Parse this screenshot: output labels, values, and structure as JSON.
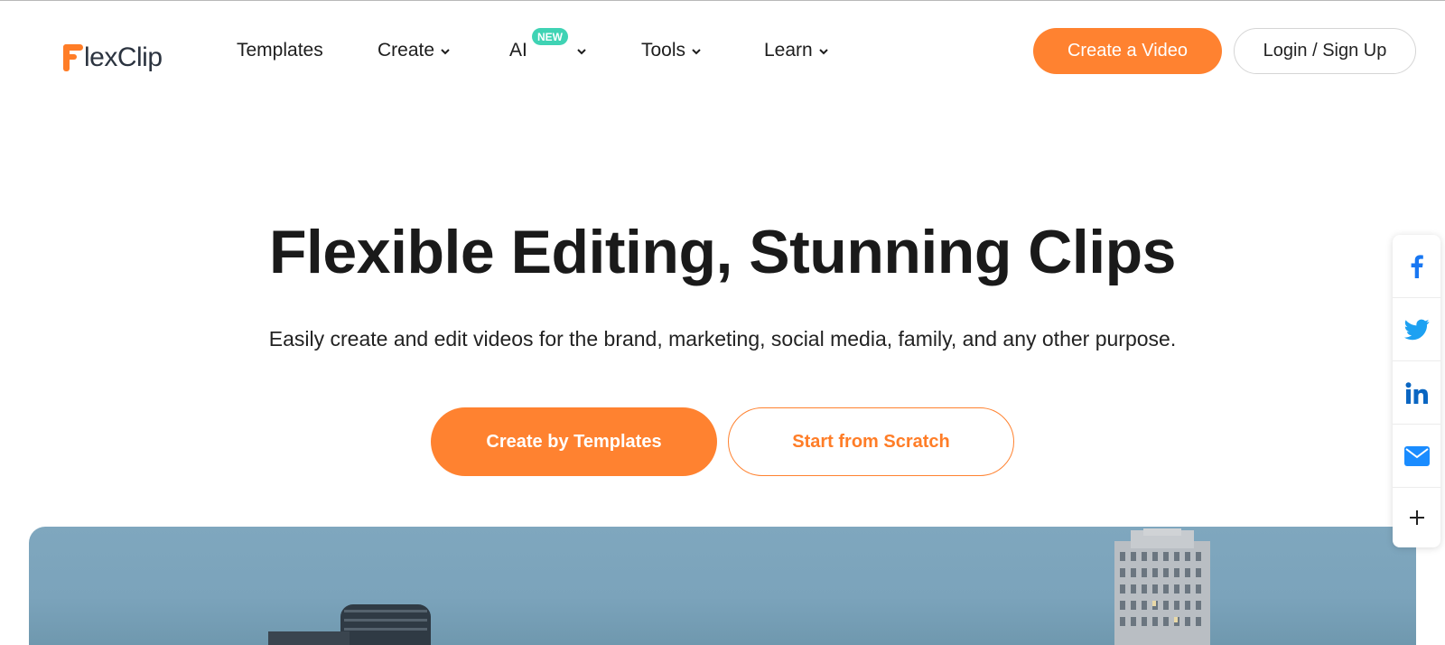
{
  "brand": {
    "logo_text": "lexClip",
    "accent_color": "#ff8230",
    "badge_color": "#3fd3b4"
  },
  "nav": {
    "items": [
      {
        "label": "Templates",
        "has_dropdown": false
      },
      {
        "label": "Create",
        "has_dropdown": true
      },
      {
        "label": "AI",
        "has_dropdown": true,
        "badge": "NEW"
      },
      {
        "label": "Tools",
        "has_dropdown": true
      },
      {
        "label": "Learn",
        "has_dropdown": true
      }
    ],
    "create_video_label": "Create a Video",
    "login_label": "Login / Sign Up"
  },
  "hero": {
    "title": "Flexible Editing, Stunning Clips",
    "subtitle": "Easily create and edit videos for the brand, marketing, social media, family, and any other purpose.",
    "primary_cta": "Create by Templates",
    "secondary_cta": "Start from Scratch"
  },
  "share": {
    "items": [
      {
        "name": "facebook",
        "icon": "facebook-icon",
        "color": "#1877f2"
      },
      {
        "name": "twitter",
        "icon": "twitter-icon",
        "color": "#1da1f2"
      },
      {
        "name": "linkedin",
        "icon": "linkedin-icon",
        "color": "#0a66c2"
      },
      {
        "name": "email",
        "icon": "mail-icon",
        "color": "#1a8cff"
      },
      {
        "name": "more",
        "icon": "plus-icon",
        "color": "#222222"
      }
    ]
  }
}
